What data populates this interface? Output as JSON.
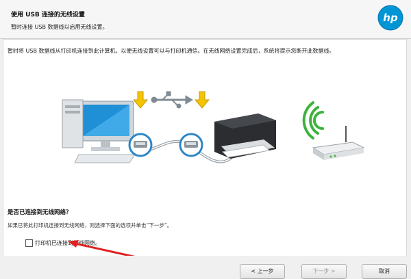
{
  "header": {
    "title": "使用 USB 连接的无线设置",
    "subtitle": "暂时连接 USB 数据线以启用无线设置。",
    "logo_text": "hp"
  },
  "main": {
    "instruction": "暂时将 USB 数据线从打印机连接到此计算机，以便无线设置可以与打印机通信。在无线网络设置完成后，系统将提示您断开此数据线。",
    "question": "是否已连接到无线网络？",
    "question_hint": "如果已将此打印机连接到无线网络，则选择下面的选项并单击“下一步”。",
    "checkbox": {
      "label": "打印机已连接到无线网络。",
      "checked": false
    }
  },
  "footer": {
    "back_label": "< 上一步",
    "next_label": "下一步 >",
    "cancel_label": "取消"
  },
  "colors": {
    "hp_blue": "#0096d6",
    "arrow_yellow": "#f5c400",
    "wifi_green": "#3db33d",
    "annotation_red": "#e02020"
  }
}
